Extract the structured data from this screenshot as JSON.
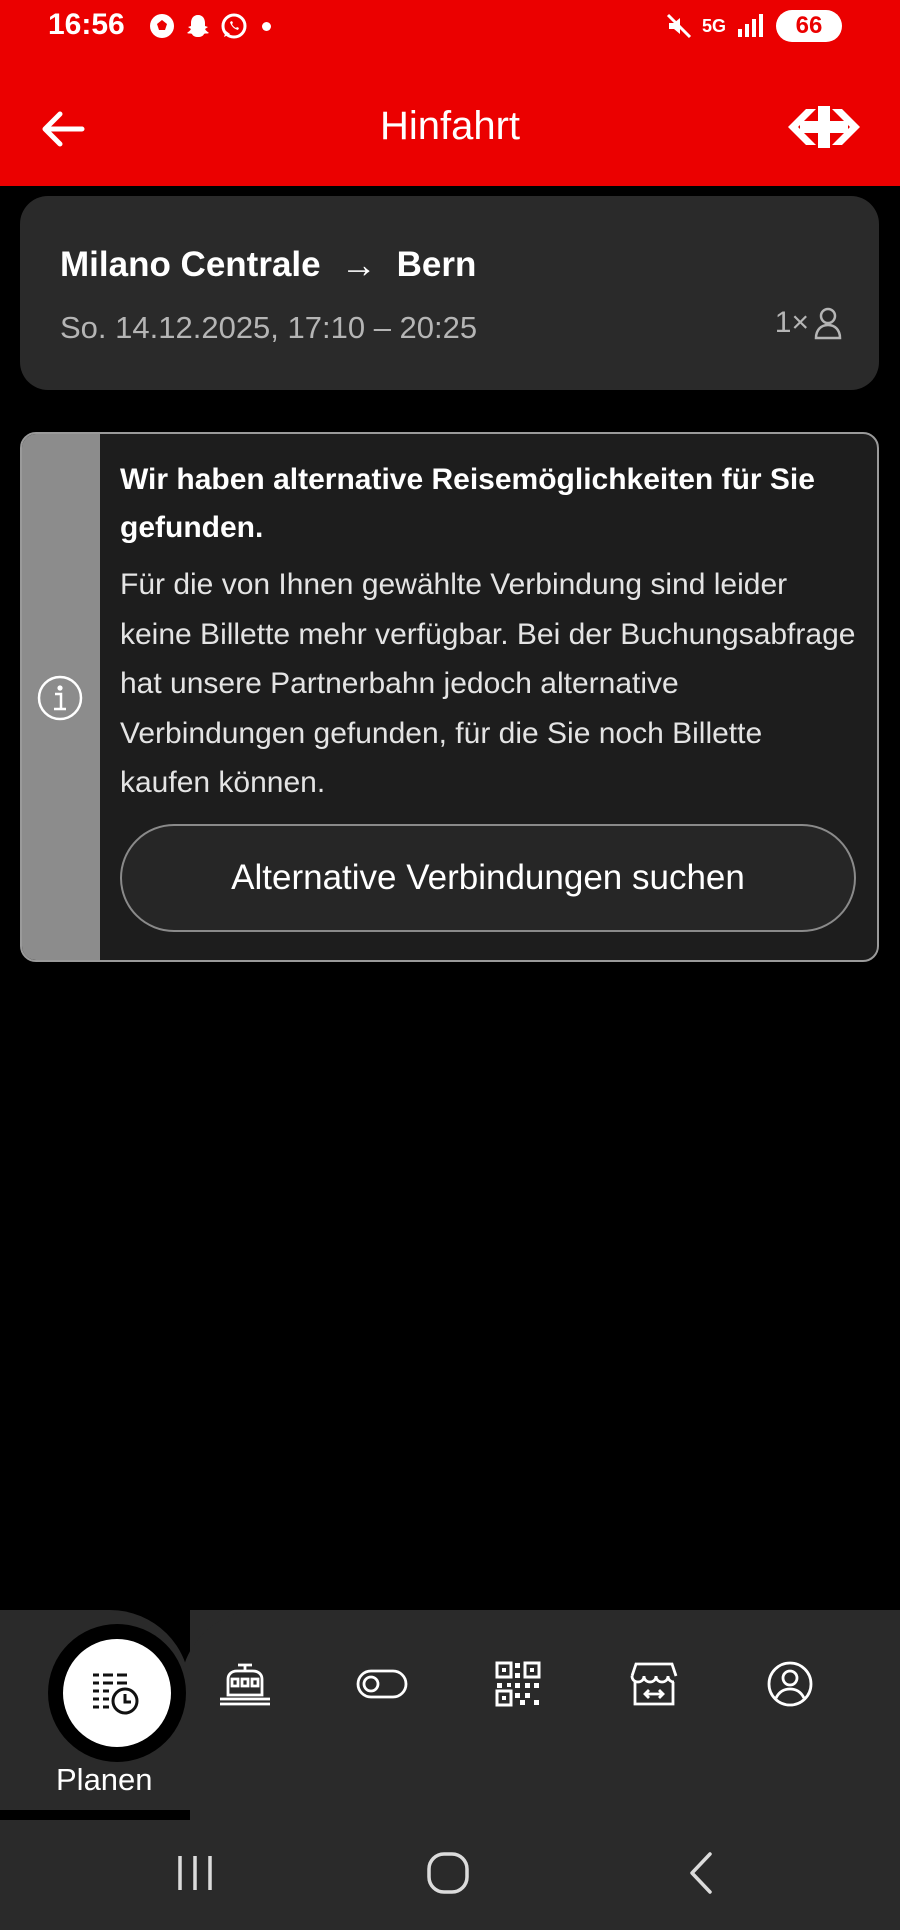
{
  "status_bar": {
    "time": "16:56",
    "battery": "66",
    "network": "5G"
  },
  "header": {
    "title": "Hinfahrt"
  },
  "trip": {
    "from": "Milano Centrale",
    "arrow": "→",
    "to": "Bern",
    "datetime": "So. 14.12.2025, 17:10 – 20:25",
    "passengers": "1×"
  },
  "info_box": {
    "heading": "Wir haben alternative Reisemöglichkeiten für Sie gefunden.",
    "body": "Für die von Ihnen gewählte Verbindung sind leider keine Billette mehr verfügbar. Bei der Buchungsabfrage hat unsere Partnerbahn jedoch alternative Verbindungen gefunden, für die Sie noch Billette kaufen können.",
    "button_label": "Alternative Verbindungen suchen"
  },
  "bottom_nav": {
    "active_label": "Planen",
    "items": [
      "timetable-icon",
      "train-icon",
      "toggle-icon",
      "qr-code-icon",
      "shop-icon",
      "profile-icon"
    ]
  },
  "colors": {
    "brand_red": "#eb0000",
    "card_bg": "#2a2a2a",
    "info_strip": "#8c8c8c"
  }
}
